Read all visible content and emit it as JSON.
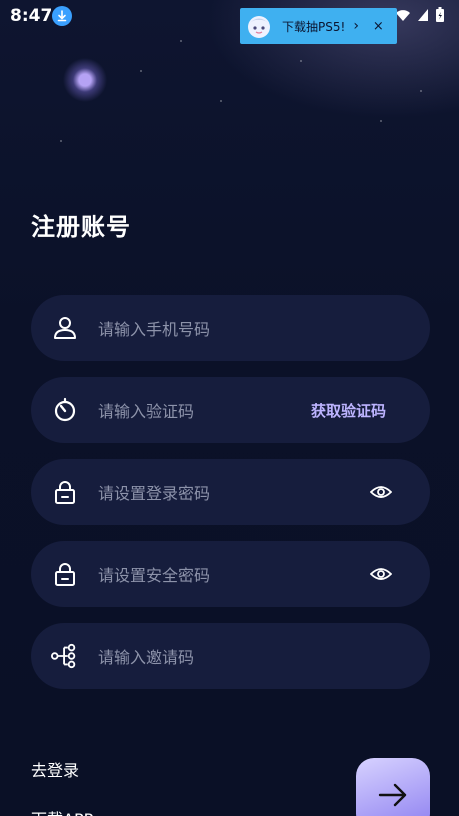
{
  "status_bar": {
    "time": "8:47"
  },
  "promo": {
    "text": "下载抽PS5!",
    "chevron": "›",
    "close": "×"
  },
  "page": {
    "title": "注册账号"
  },
  "form": {
    "phone_placeholder": "请输入手机号码",
    "code_placeholder": "请输入验证码",
    "get_code_label": "获取验证码",
    "login_password_placeholder": "请设置登录密码",
    "security_password_placeholder": "请设置安全密码",
    "invite_code_placeholder": "请输入邀请码"
  },
  "footer": {
    "login_link": "去登录",
    "download_link": "下载APP"
  },
  "icons": {
    "user": "user-icon",
    "timer": "timer-icon",
    "lock": "lock-icon",
    "eye": "eye-icon",
    "invite": "invite-icon",
    "arrow": "arrow-right-icon"
  },
  "colors": {
    "background": "#0b1128",
    "field_bg": "#161d3d",
    "accent": "#bdb4ff",
    "button_gradient_start": "#d7d2ff",
    "button_gradient_end": "#8c7ef0"
  }
}
